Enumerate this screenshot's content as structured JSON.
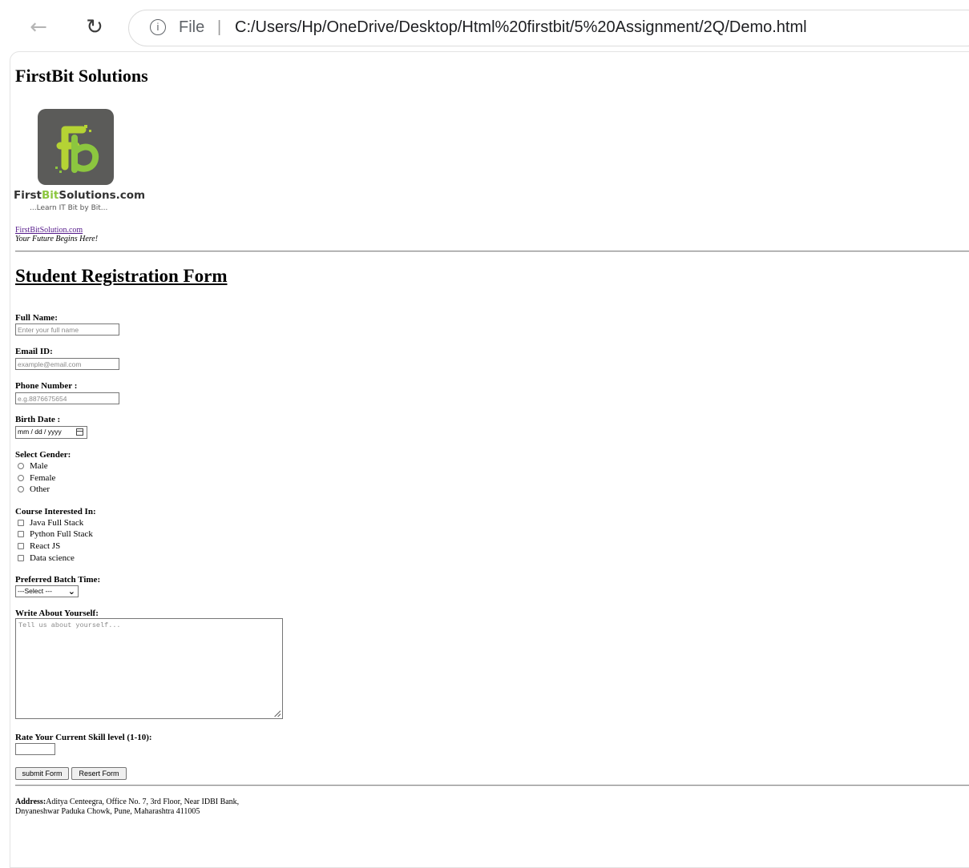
{
  "browser": {
    "file_label": "File",
    "separator": "|",
    "url": "C:/Users/Hp/OneDrive/Desktop/Html%20firstbit/5%20Assignment/2Q/Demo.html"
  },
  "site": {
    "title": "FirstBit Solutions",
    "logo_text_a": "First",
    "logo_text_b": "Bit",
    "logo_text_c": "Solutions.com",
    "logo_tagline": "...Learn IT Bit by Bit...",
    "link_text": "FirstBitSolution.com",
    "tagline": "Your Future Begins Here!"
  },
  "form": {
    "title": "Student Registration Form",
    "full_name": {
      "label": "Full Name:",
      "placeholder": "Enter your full name"
    },
    "email": {
      "label": "Email ID:",
      "placeholder": "example@email.com"
    },
    "phone": {
      "label": "Phone Number :",
      "placeholder": "e.g.8876675654"
    },
    "birth": {
      "label": "Birth Date :",
      "value": "mm / dd / yyyy"
    },
    "gender": {
      "label": "Select Gender:",
      "options": [
        "Male",
        "Female",
        "Other"
      ]
    },
    "courses": {
      "label": "Course Interested In:",
      "options": [
        "Java Full Stack",
        "Python Full Stack",
        "React JS",
        "Data science"
      ]
    },
    "batch": {
      "label": "Preferred Batch Time:",
      "selected": "---Select ---"
    },
    "about": {
      "label": "Write About Yourself:",
      "placeholder": "Tell us about yourself..."
    },
    "skill": {
      "label": "Rate Your Current Skill level (1-10):"
    },
    "submit_label": "submit Form",
    "reset_label": "Resert Form"
  },
  "footer": {
    "address_label": "Address:",
    "address_line1": "Aditya Centeegra, Office No. 7, 3rd Floor, Near IDBI Bank,",
    "address_line2": "Dnyaneshwar Paduka Chowk, Pune, Maharashtra 411005"
  },
  "colors": {
    "logo_bg": "#5b5b59",
    "logo_accent": "#8cc63f",
    "link": "#551a8b"
  },
  "icons": [
    "back-arrow-icon",
    "reload-icon",
    "info-icon",
    "calendar-icon",
    "chevron-down-icon",
    "resize-grip-icon"
  ]
}
